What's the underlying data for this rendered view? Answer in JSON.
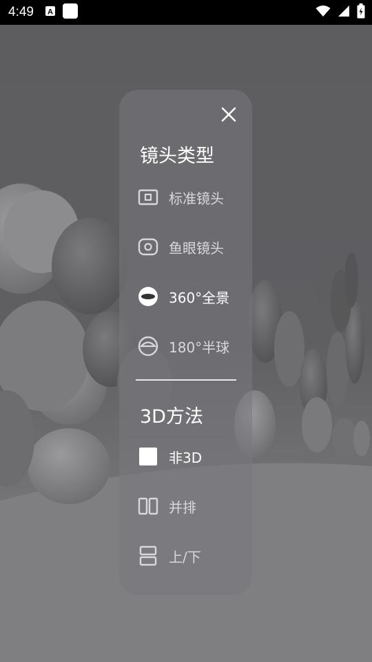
{
  "status_bar": {
    "time": "4:49",
    "icons": [
      "a-icon",
      "square-icon",
      "wifi-icon",
      "signal-icon",
      "battery-icon"
    ]
  },
  "panel": {
    "lens_title": "镜头类型",
    "lens_items": [
      {
        "label": "标准镜头",
        "icon": "standard-lens-icon"
      },
      {
        "label": "鱼眼镜头",
        "icon": "fisheye-lens-icon"
      },
      {
        "label": "360°全景",
        "icon": "panorama-360-icon",
        "selected": true
      },
      {
        "label": "180°半球",
        "icon": "hemisphere-180-icon"
      }
    ],
    "method_title": "3D方法",
    "method_items": [
      {
        "label": "非3D",
        "icon": "non-3d-icon",
        "selected": true
      },
      {
        "label": "并排",
        "icon": "side-by-side-icon"
      },
      {
        "label": "上/下",
        "icon": "top-bottom-icon"
      }
    ]
  },
  "colors": {
    "panel_bg": "#78787d",
    "text": "#ffffff",
    "muted_text": "#d9d9dc"
  }
}
